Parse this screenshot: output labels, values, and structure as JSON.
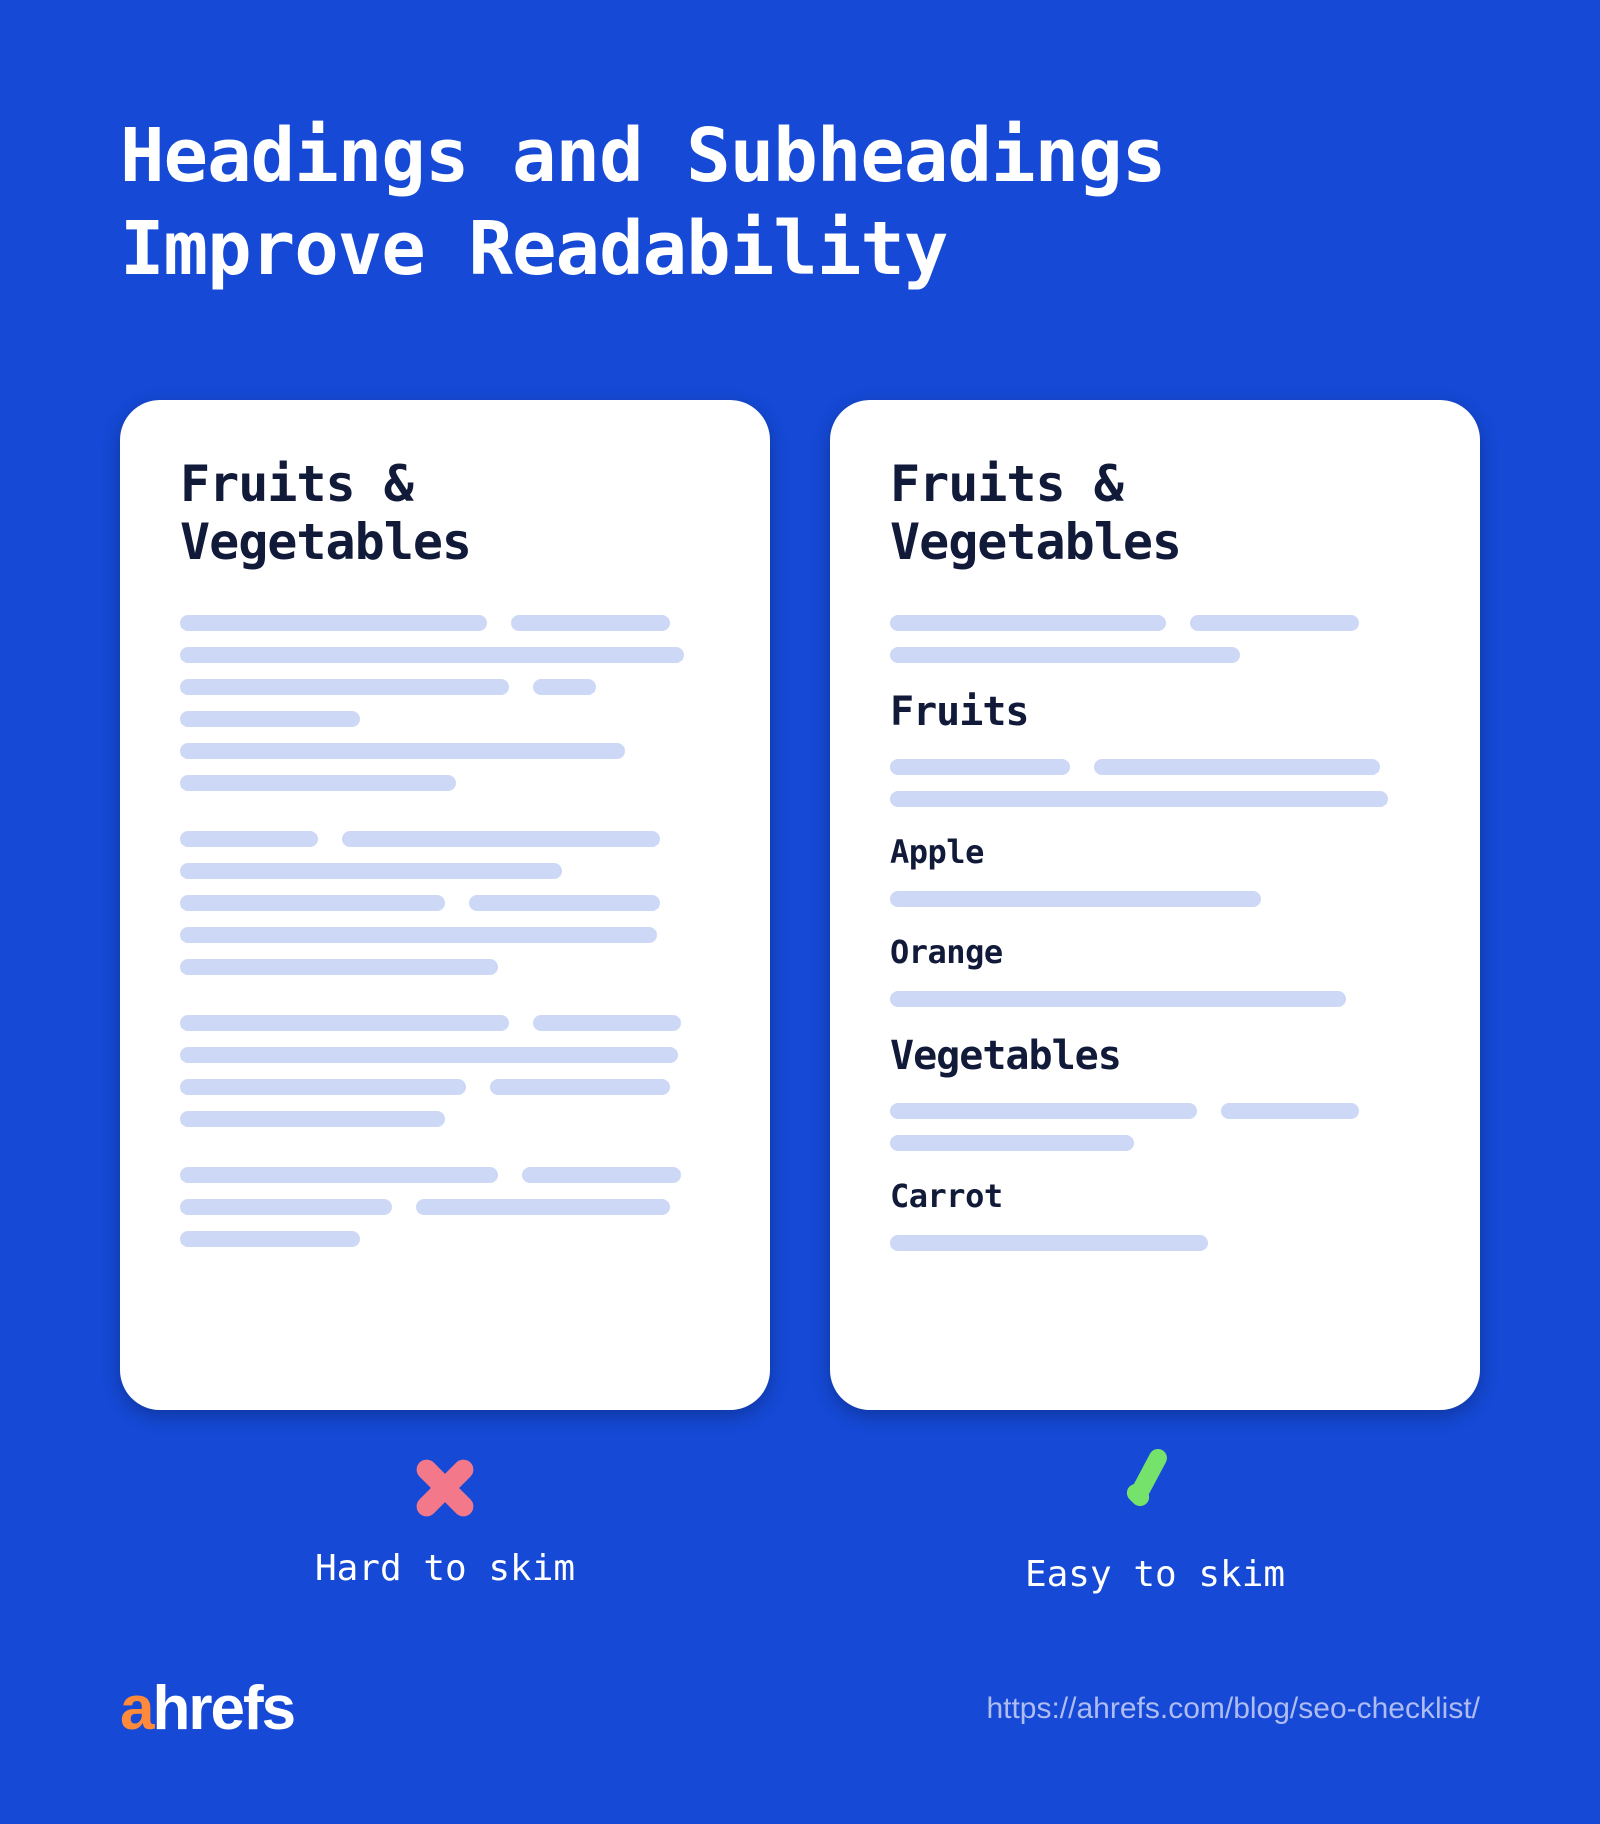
{
  "title_line1": "Headings and Subheadings",
  "title_line2": "Improve Readability",
  "left": {
    "heading": "Fruits & Vegetables",
    "status": "Hard to skim"
  },
  "right": {
    "heading": "Fruits & Vegetables",
    "sections": {
      "h2a": "Fruits",
      "h3a": "Apple",
      "h3b": "Orange",
      "h2b": "Vegetables",
      "h3c": "Carrot"
    },
    "status": "Easy to skim"
  },
  "footer": {
    "brand_a": "a",
    "brand_rest": "hrefs",
    "url": "https://ahrefs.com/blog/seo-checklist/"
  },
  "colors": {
    "bg": "#1549d6",
    "bar": "#ccd8f6",
    "bad": "#f3798a",
    "good": "#75e26b",
    "accent": "#ff8a3c"
  }
}
